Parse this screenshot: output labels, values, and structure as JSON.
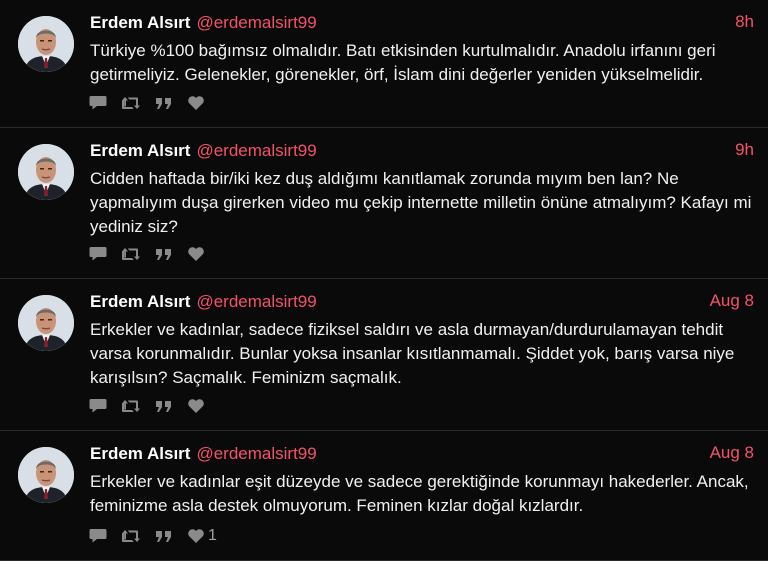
{
  "tweets": [
    {
      "name": "Erdem Alsırt",
      "handle": "@erdemalsirt99",
      "time": "8h",
      "text": "Türkiye %100 bağımsız olmalıdır. Batı etkisinden kurtulmalıdır. Anadolu irfanını geri getirmeliyiz. Gelenekler, görenekler, örf, İslam dini değerler yeniden yükselmelidir.",
      "like_count": ""
    },
    {
      "name": "Erdem Alsırt",
      "handle": "@erdemalsirt99",
      "time": "9h",
      "text": "Cidden haftada bir/iki kez duş aldığımı kanıtlamak zorunda mıyım ben lan? Ne yapmalıyım duşa girerken video mu çekip internette milletin önüne atmalıyım? Kafayı mi yediniz siz?",
      "like_count": ""
    },
    {
      "name": "Erdem Alsırt",
      "handle": "@erdemalsirt99",
      "time": "Aug 8",
      "text": "Erkekler ve kadınlar, sadece fiziksel saldırı ve asla durmayan/durdurulamayan tehdit varsa korunmalıdır. Bunlar yoksa insanlar kısıtlanmamalı. Şiddet yok, barış varsa niye karışılsın? Saçmalık. Feminizm saçmalık.",
      "like_count": ""
    },
    {
      "name": "Erdem Alsırt",
      "handle": "@erdemalsirt99",
      "time": "Aug 8",
      "text": "Erkekler ve kadınlar eşit düzeyde ve sadece gerektiğinde korunmayı hakederler. Ancak, feminizme asla destek olmuyorum. Feminen kızlar doğal kızlardır.",
      "like_count": "1"
    }
  ],
  "icons": {
    "reply": "speech-bubble-icon",
    "retweet": "retweet-icon",
    "quote": "quote-icon",
    "like": "heart-icon"
  },
  "colors": {
    "background": "#0a0a0a",
    "accent": "#f4516b",
    "text": "#f1f1f1",
    "icon": "#8a8a8a",
    "divider": "#2b2b2b"
  }
}
